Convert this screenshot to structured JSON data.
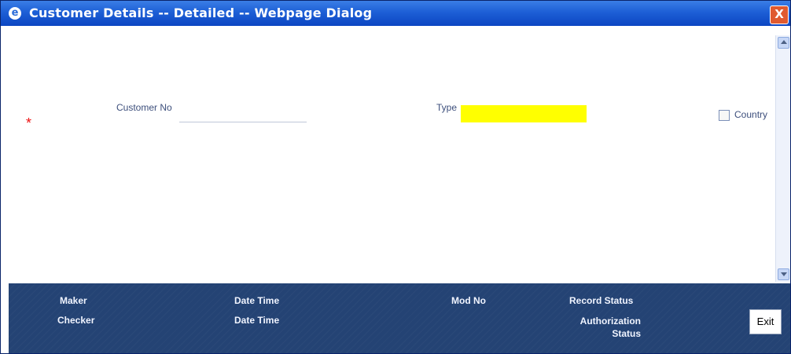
{
  "window": {
    "title": "Customer Details -- Detailed -- Webpage Dialog",
    "title_icon": "e",
    "close_icon": "X"
  },
  "form": {
    "required_marker": "*",
    "customer_no_label": "Customer No",
    "customer_no_value": "",
    "type_label": "Type",
    "type_value": "",
    "country_label": "Country"
  },
  "footer": {
    "maker_label": "Maker",
    "checker_label": "Checker",
    "date_time_label_1": "Date Time",
    "date_time_label_2": "Date Time",
    "mod_no_label": "Mod No",
    "record_status_label": "Record Status",
    "authorization_label_line1": "Authorization",
    "authorization_label_line2": "Status",
    "exit_label": "Exit"
  },
  "colors": {
    "title_gradient_start": "#3a7ee6",
    "title_gradient_end": "#0c46c2",
    "footer_background": "#244374",
    "required_marker": "#e11111",
    "type_highlight": "#ffff00"
  }
}
